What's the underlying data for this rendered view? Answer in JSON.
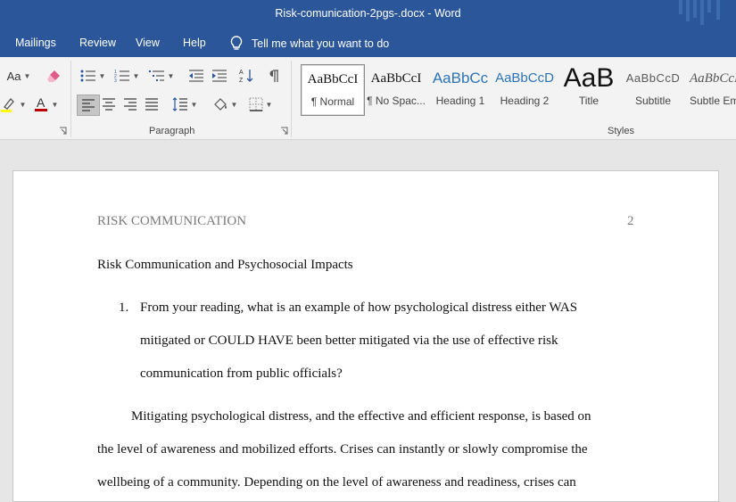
{
  "titlebar": {
    "title": "Risk-comunication-2pgs-.docx  -  Word"
  },
  "tabs": [
    "Mailings",
    "Review",
    "View",
    "Help"
  ],
  "tell_me": {
    "label": "Tell me what you want to do"
  },
  "ribbon": {
    "font_case_label": "Aa",
    "groups": {
      "paragraph": "Paragraph",
      "styles": "Styles"
    },
    "styles": [
      {
        "sample": "AaBbCcI",
        "label": "¶ Normal"
      },
      {
        "sample": "AaBbCcI",
        "label": "¶ No Spac..."
      },
      {
        "sample": "AaBbCc",
        "label": "Heading 1"
      },
      {
        "sample": "AaBbCcD",
        "label": "Heading 2"
      },
      {
        "sample": "AaB",
        "label": "Title"
      },
      {
        "sample": "AaBbCcD",
        "label": "Subtitle"
      },
      {
        "sample": "AaBbCcD",
        "label": "Subtle Em"
      }
    ],
    "colors": {
      "highlight": "#ffff00",
      "font_color": "#c00000"
    }
  },
  "document": {
    "header_left": "RISK COMMUNICATION",
    "page_number": "2",
    "title": "Risk Communication and Psychosocial Impacts",
    "question_number": "1.",
    "question_lines": [
      "From your reading, what is an example of how psychological distress either WAS",
      "mitigated or COULD HAVE been better mitigated via the use of effective risk",
      "communication from public officials?"
    ],
    "paragraph_lines": [
      "Mitigating psychological distress, and the effective and efficient response, is based on",
      "the level of awareness and mobilized efforts. Crises can instantly or slowly compromise the",
      "wellbeing of a community. Depending on the level of awareness and readiness, crises can"
    ]
  },
  "theme": {
    "accent": "#2b579a",
    "ribbon_bg": "#f3f3f3",
    "doc_bg": "#e6e6e6"
  }
}
